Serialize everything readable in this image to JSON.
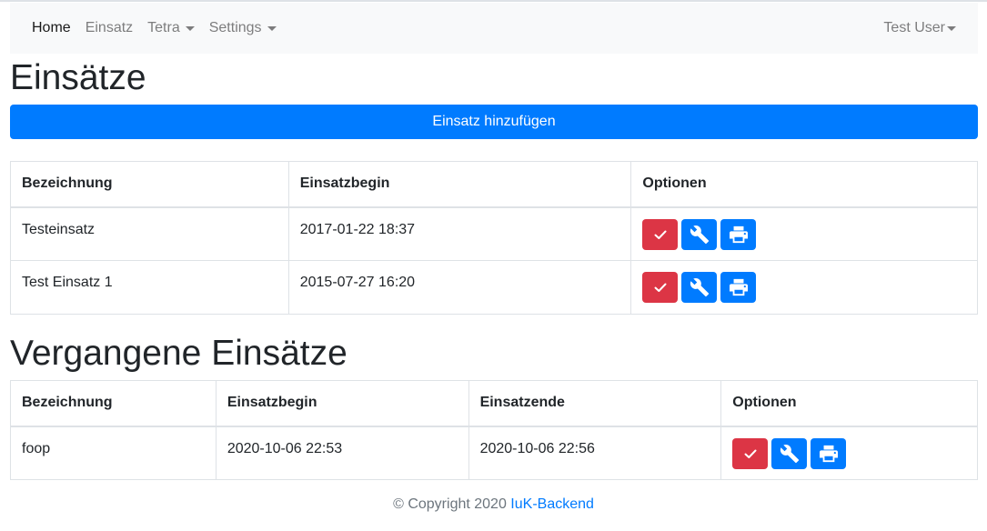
{
  "nav": {
    "home": "Home",
    "einsatz": "Einsatz",
    "tetra": "Tetra",
    "settings": "Settings",
    "user": "Test User"
  },
  "current": {
    "heading": "Einsätze",
    "add_button": "Einsatz hinzufügen",
    "columns": [
      "Bezeichnung",
      "Einsatzbegin",
      "Optionen"
    ],
    "rows": [
      {
        "name": "Testeinsatz",
        "begin": "2017-01-22 18:37"
      },
      {
        "name": "Test Einsatz 1",
        "begin": "2015-07-27 16:20"
      }
    ]
  },
  "past": {
    "heading": "Vergangene Einsätze",
    "columns": [
      "Bezeichnung",
      "Einsatzbegin",
      "Einsatzende",
      "Optionen"
    ],
    "rows": [
      {
        "name": "foop",
        "begin": "2020-10-06 22:53",
        "end": "2020-10-06 22:56"
      }
    ]
  },
  "icons": {
    "close": "check-icon",
    "edit": "wrench-icon",
    "print": "print-icon"
  },
  "colors": {
    "primary": "#007bff",
    "danger": "#dc3545",
    "navbar_bg": "#f8f9fa"
  },
  "footer": {
    "copyright": "© Copyright 2020",
    "link": "IuK-Backend"
  }
}
